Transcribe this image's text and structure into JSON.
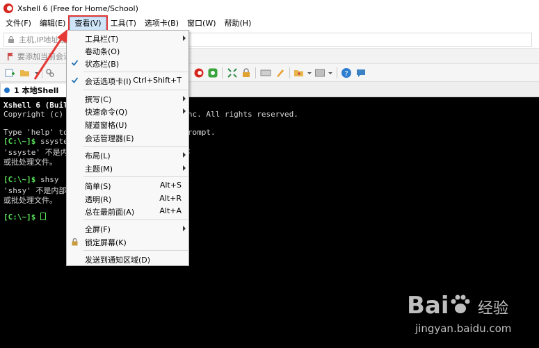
{
  "window": {
    "title": "Xshell 6 (Free for Home/School)"
  },
  "menubar": {
    "items": [
      "文件(F)",
      "编辑(E)",
      "查看(V)",
      "工具(T)",
      "选项卡(B)",
      "窗口(W)",
      "帮助(H)"
    ],
    "active": "查看(V)"
  },
  "address": {
    "placeholder": "主机,IP地址或会话名称"
  },
  "hint": {
    "text": "要添加当前会话，点击左侧的箭头按钮。"
  },
  "tab": {
    "label": "1 本地Shell",
    "close": "×"
  },
  "terminal": {
    "lines": [
      {
        "text": "Xshell 6 (Build 0197)"
      },
      {
        "text": "Copyright (c) 2002 NetSarang Computer, Inc. All rights reserved."
      },
      {
        "text": ""
      },
      {
        "text": "Type 'help' to learn how to use Xshell prompt."
      },
      {
        "prompt": "[C:\\~]$",
        "text": " ssyste"
      },
      {
        "text": "'ssyste' 不是内部或外部命令，也不是可运行的程序"
      },
      {
        "text": "或批处理文件。"
      },
      {
        "text": ""
      },
      {
        "prompt": "[C:\\~]$",
        "text": " shsy"
      },
      {
        "text": "'shsy' 不是内部或外部命令，也不是可运行的程序"
      },
      {
        "text": "或批处理文件。"
      },
      {
        "text": ""
      },
      {
        "prompt": "[C:\\~]$",
        "text": " ",
        "cursor": true
      }
    ]
  },
  "view_menu": {
    "items": [
      {
        "label": "工具栏(T)",
        "submenu": true
      },
      {
        "label": "卷动条(O)"
      },
      {
        "label": "状态栏(B)",
        "checked": true
      },
      {
        "sep": true
      },
      {
        "label": "会话选项卡(I)",
        "shortcut": "Ctrl+Shift+T",
        "checked": true
      },
      {
        "sep": true
      },
      {
        "label": "撰写(C)",
        "submenu": true
      },
      {
        "label": "快速命令(Q)",
        "submenu": true
      },
      {
        "label": "隧道窗格(U)"
      },
      {
        "label": "会话管理器(E)"
      },
      {
        "sep": true
      },
      {
        "label": "布局(L)",
        "submenu": true
      },
      {
        "label": "主题(M)",
        "submenu": true
      },
      {
        "sep": true
      },
      {
        "label": "简单(S)",
        "shortcut": "Alt+S"
      },
      {
        "label": "透明(R)",
        "shortcut": "Alt+R"
      },
      {
        "label": "总在最前面(A)",
        "shortcut": "Alt+A"
      },
      {
        "sep": true
      },
      {
        "label": "全屏(F)",
        "submenu": true
      },
      {
        "label": "锁定屏幕(K)",
        "icon": "lock-icon"
      },
      {
        "sep": true
      },
      {
        "label": "发送到通知区域(D)"
      }
    ]
  },
  "watermark": {
    "logo": "Bai",
    "cn": "经验",
    "url": "jingyan.baidu.com"
  },
  "colors": {
    "prompt": "#59e359",
    "terminal_bg": "#000000",
    "annotation": "#e53935",
    "highlight": "#cfe6fa"
  }
}
